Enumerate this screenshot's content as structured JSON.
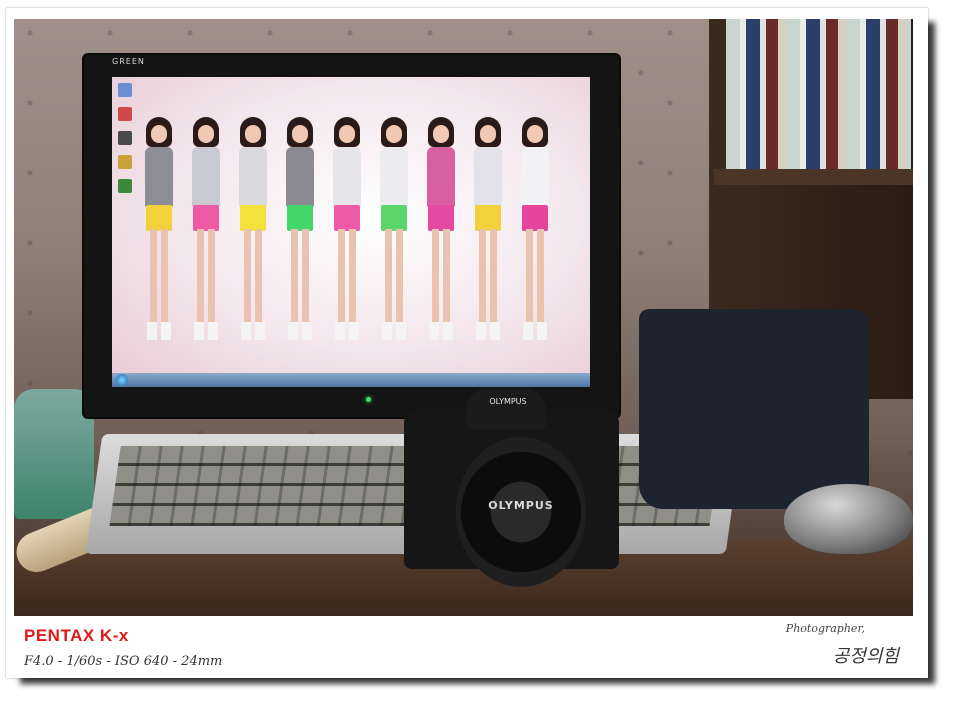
{
  "monitor": {
    "brand_label": "GREEN"
  },
  "screen": {
    "girls": [
      {
        "top_color": "#8d8d95",
        "shorts_color": "#f2d23a"
      },
      {
        "top_color": "#c9c9d1",
        "shorts_color": "#ee5aa5"
      },
      {
        "top_color": "#d8d8dd",
        "shorts_color": "#f2e23a"
      },
      {
        "top_color": "#8a8a90",
        "shorts_color": "#43d66a"
      },
      {
        "top_color": "#e6e6ea",
        "shorts_color": "#ee5aa5"
      },
      {
        "top_color": "#ececf0",
        "shorts_color": "#5bd66a"
      },
      {
        "top_color": "#d85fa0",
        "shorts_color": "#e34aa0"
      },
      {
        "top_color": "#e2e2e8",
        "shorts_color": "#f2d23a"
      },
      {
        "top_color": "#f2f2f4",
        "shorts_color": "#e5469b"
      }
    ]
  },
  "camera": {
    "top_brand": "OLYMPUS",
    "lens_brand": "OLYMPUS"
  },
  "caption": {
    "camera_model": "PENTAX K-x",
    "exif_line": "F4.0 - 1/60s - ISO 640 - 24mm",
    "photographer_label": "Photographer,",
    "signature": "공정의힘"
  }
}
